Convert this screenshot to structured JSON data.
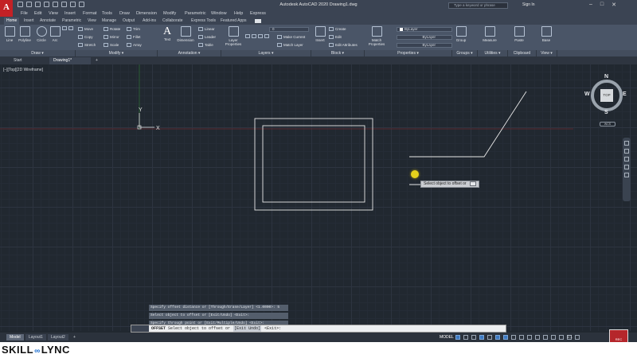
{
  "app": {
    "logo": "A",
    "title": "Autodesk AutoCAD 2020    Drawing1.dwg",
    "search_placeholder": "Type a keyword or phrase",
    "sign_in": "Sign In"
  },
  "menus": [
    "File",
    "Edit",
    "View",
    "Insert",
    "Format",
    "Tools",
    "Draw",
    "Dimension",
    "Modify",
    "Parametric",
    "Window",
    "Help",
    "Express"
  ],
  "ribbon_tabs": [
    "Home",
    "Insert",
    "Annotate",
    "Parametric",
    "View",
    "Manage",
    "Output",
    "Add-ins",
    "Collaborate",
    "Express Tools",
    "Featured Apps"
  ],
  "ribbon": {
    "draw": {
      "line": "Line",
      "polyline": "Polyline",
      "circle": "Circle",
      "arc": "Arc"
    },
    "modify": {
      "move": "Move",
      "rotate": "Rotate",
      "trim": "Trim",
      "copy": "Copy",
      "mirror": "Mirror",
      "fillet": "Fillet",
      "stretch": "Stretch",
      "scale": "Scale",
      "array": "Array"
    },
    "annotation": {
      "text": "Text",
      "dimension": "Dimension",
      "linear": "Linear",
      "leader": "Leader",
      "table": "Table"
    },
    "layers": {
      "layer_properties": "Layer Properties",
      "layer_value": "0",
      "make_current": "Make Current",
      "match_layer": "Match Layer"
    },
    "block": {
      "insert": "Insert",
      "create": "Create",
      "edit": "Edit",
      "edit_attributes": "Edit Attributes"
    },
    "properties": {
      "match_properties": "Match Properties",
      "bylayer_1": "ByLayer",
      "bylayer_2": "ByLayer",
      "bylayer_3": "ByLayer"
    },
    "groups": {
      "group": "Group"
    },
    "utilities": {
      "measure": "Measure"
    },
    "clipboard": {
      "paste": "Paste"
    },
    "view": {
      "base": "Base"
    },
    "panels": [
      "Draw ▾",
      "Modify ▾",
      "Annotation ▾",
      "Layers ▾",
      "Block ▾",
      "Properties ▾",
      "Groups ▾",
      "Utilities ▾",
      "Clipboard",
      "View ▾"
    ]
  },
  "doc_tabs": [
    "Start",
    "Drawing1*",
    "+"
  ],
  "viewport": {
    "label": "[–][Top][2D Wireframe]",
    "ucs_x": "X",
    "ucs_y": "Y"
  },
  "viewcube": {
    "top": "TOP",
    "n": "N",
    "s": "S",
    "e": "E",
    "w": "W",
    "wcs": "WCS"
  },
  "tooltip": {
    "text": "Select object to offset or"
  },
  "command_history": [
    "Specify offset distance or [Through/Erase/Layer] <1.0000>: 5",
    "Select object to offset or [Exit/Undo] <Exit>:",
    "Specify through point or [Exit/Multiple/Undo] <Exit>:"
  ],
  "command_line": {
    "command": "OFFSET",
    "prompt": "Select object to offset or",
    "options": "[Exit Undo]",
    "default": "<Exit>:"
  },
  "layout_tabs": [
    "Model",
    "Layout1",
    "Layout2",
    "+"
  ],
  "status": {
    "model": "MODEL",
    "scale": "1:1"
  },
  "branding": {
    "left": "SKILL",
    "right": "LYNC",
    "link": "∞"
  },
  "rec_label": "REC"
}
